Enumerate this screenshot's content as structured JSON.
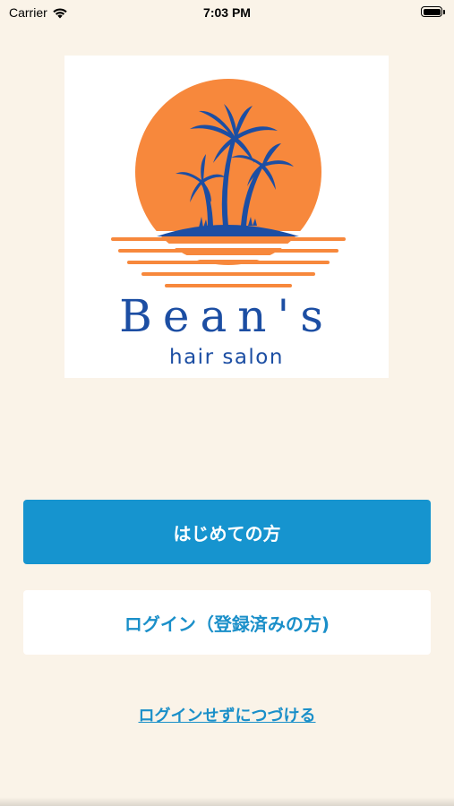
{
  "status_bar": {
    "carrier": "Carrier",
    "time": "7:03 PM",
    "icons": [
      "wifi-icon",
      "battery-icon"
    ]
  },
  "logo": {
    "brand_name": "Bean's",
    "brand_sub": "hair salon",
    "colors": {
      "sun": "#f7883c",
      "ink": "#1c4ea3"
    }
  },
  "actions": {
    "first_time_label": "はじめての方",
    "login_label": "ログイン（登録済みの方)",
    "skip_label": "ログインせずにつづける"
  },
  "colors": {
    "background": "#faf3e8",
    "primary": "#1694cf",
    "link": "#1a8fc9"
  }
}
